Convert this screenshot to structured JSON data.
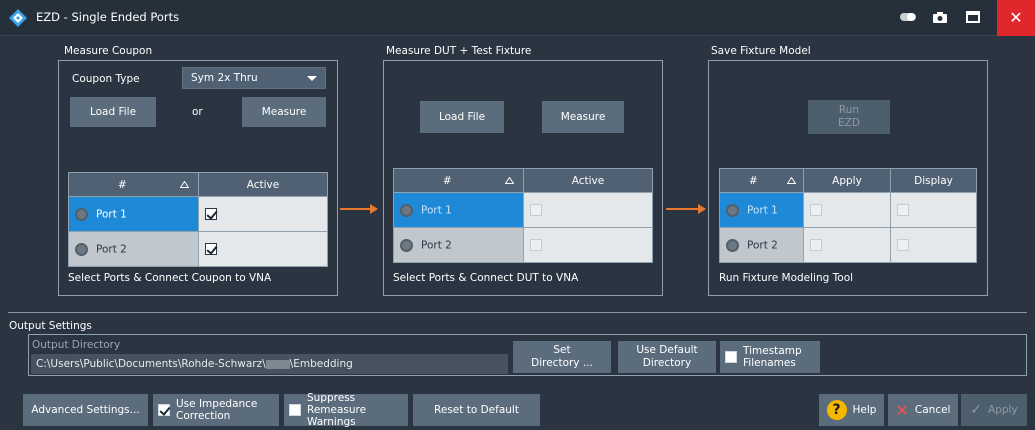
{
  "window": {
    "title": "EZD - Single Ended Ports",
    "close_glyph": "✕"
  },
  "measure_coupon": {
    "title": "Measure Coupon",
    "coupon_type_label": "Coupon Type",
    "coupon_type_value": "Sym 2x Thru",
    "load_file": "Load File",
    "or": "or",
    "measure": "Measure",
    "col_num": "#",
    "col_active": "Active",
    "port1": "Port 1",
    "port2": "Port 2",
    "hint": "Select Ports & Connect Coupon to VNA"
  },
  "measure_dut": {
    "title": "Measure DUT + Test Fixture",
    "load_file": "Load File",
    "measure": "Measure",
    "col_num": "#",
    "col_active": "Active",
    "port1": "Port 1",
    "port2": "Port 2",
    "hint": "Select Ports & Connect DUT to VNA"
  },
  "save_fixture": {
    "title": "Save Fixture Model",
    "run_line1": "Run",
    "run_line2": "EZD",
    "col_num": "#",
    "col_apply": "Apply",
    "col_display": "Display",
    "port1": "Port 1",
    "port2": "Port 2",
    "hint": "Run Fixture Modeling Tool"
  },
  "output": {
    "title": "Output Settings",
    "dir_label": "Output Directory",
    "dir_value_prefix": "C:\\Users\\Public\\Documents\\Rohde-Schwarz\\",
    "dir_value_suffix": "\\Embedding",
    "set_dir_line1": "Set",
    "set_dir_line2": "Directory ...",
    "use_default_line1": "Use Default",
    "use_default_line2": "Directory",
    "timestamp_line1": "Timestamp",
    "timestamp_line2": "Filenames"
  },
  "footer": {
    "advanced": "Advanced Settings...",
    "impedance_line1": "Use Impedance",
    "impedance_line2": "Correction",
    "suppress_line1": "Suppress Remeasure",
    "suppress_line2": "Warnings",
    "reset": "Reset to Default",
    "help": "Help",
    "help_glyph": "?",
    "cancel": "Cancel",
    "cancel_glyph": "✕",
    "apply": "Apply",
    "apply_glyph": "✓"
  },
  "colors": {
    "background": "#2a3541",
    "selected_row": "#1e89d6",
    "arrow": "#e77a2c",
    "close": "#e0272b"
  },
  "icons": {
    "logo": "rohde-schwarz-logo",
    "titlebar": [
      "toggle-icon",
      "camera-icon",
      "maximize-icon",
      "close-icon"
    ],
    "sort": "sort-triangle-icon",
    "port": "radio-icon"
  }
}
